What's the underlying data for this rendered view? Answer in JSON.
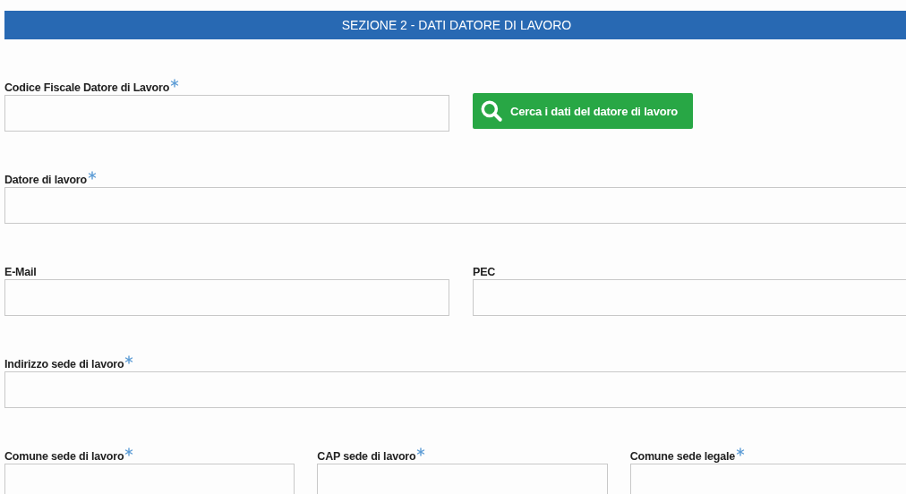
{
  "section_title": "SEZIONE 2 - DATI DATORE DI LAVORO",
  "rows": [
    {
      "items": [
        {
          "kind": "field",
          "label": "Codice Fiscale Datore di Lavoro",
          "required": true
        },
        {
          "kind": "button",
          "label": "Cerca i dati del datore di lavoro"
        }
      ]
    },
    {
      "items": [
        {
          "kind": "field",
          "label": "Datore di lavoro",
          "required": true
        }
      ]
    },
    {
      "items": [
        {
          "kind": "field",
          "label": "E-Mail",
          "required": false
        },
        {
          "kind": "field",
          "label": "PEC",
          "required": false
        }
      ]
    },
    {
      "items": [
        {
          "kind": "field",
          "label": "Indirizzo sede di lavoro",
          "required": true
        }
      ]
    },
    {
      "items": [
        {
          "kind": "field",
          "label": "Comune sede di lavoro",
          "required": true
        },
        {
          "kind": "field",
          "label": "CAP sede di lavoro",
          "required": true
        },
        {
          "kind": "field",
          "label": "Comune sede legale",
          "required": true
        }
      ]
    }
  ]
}
